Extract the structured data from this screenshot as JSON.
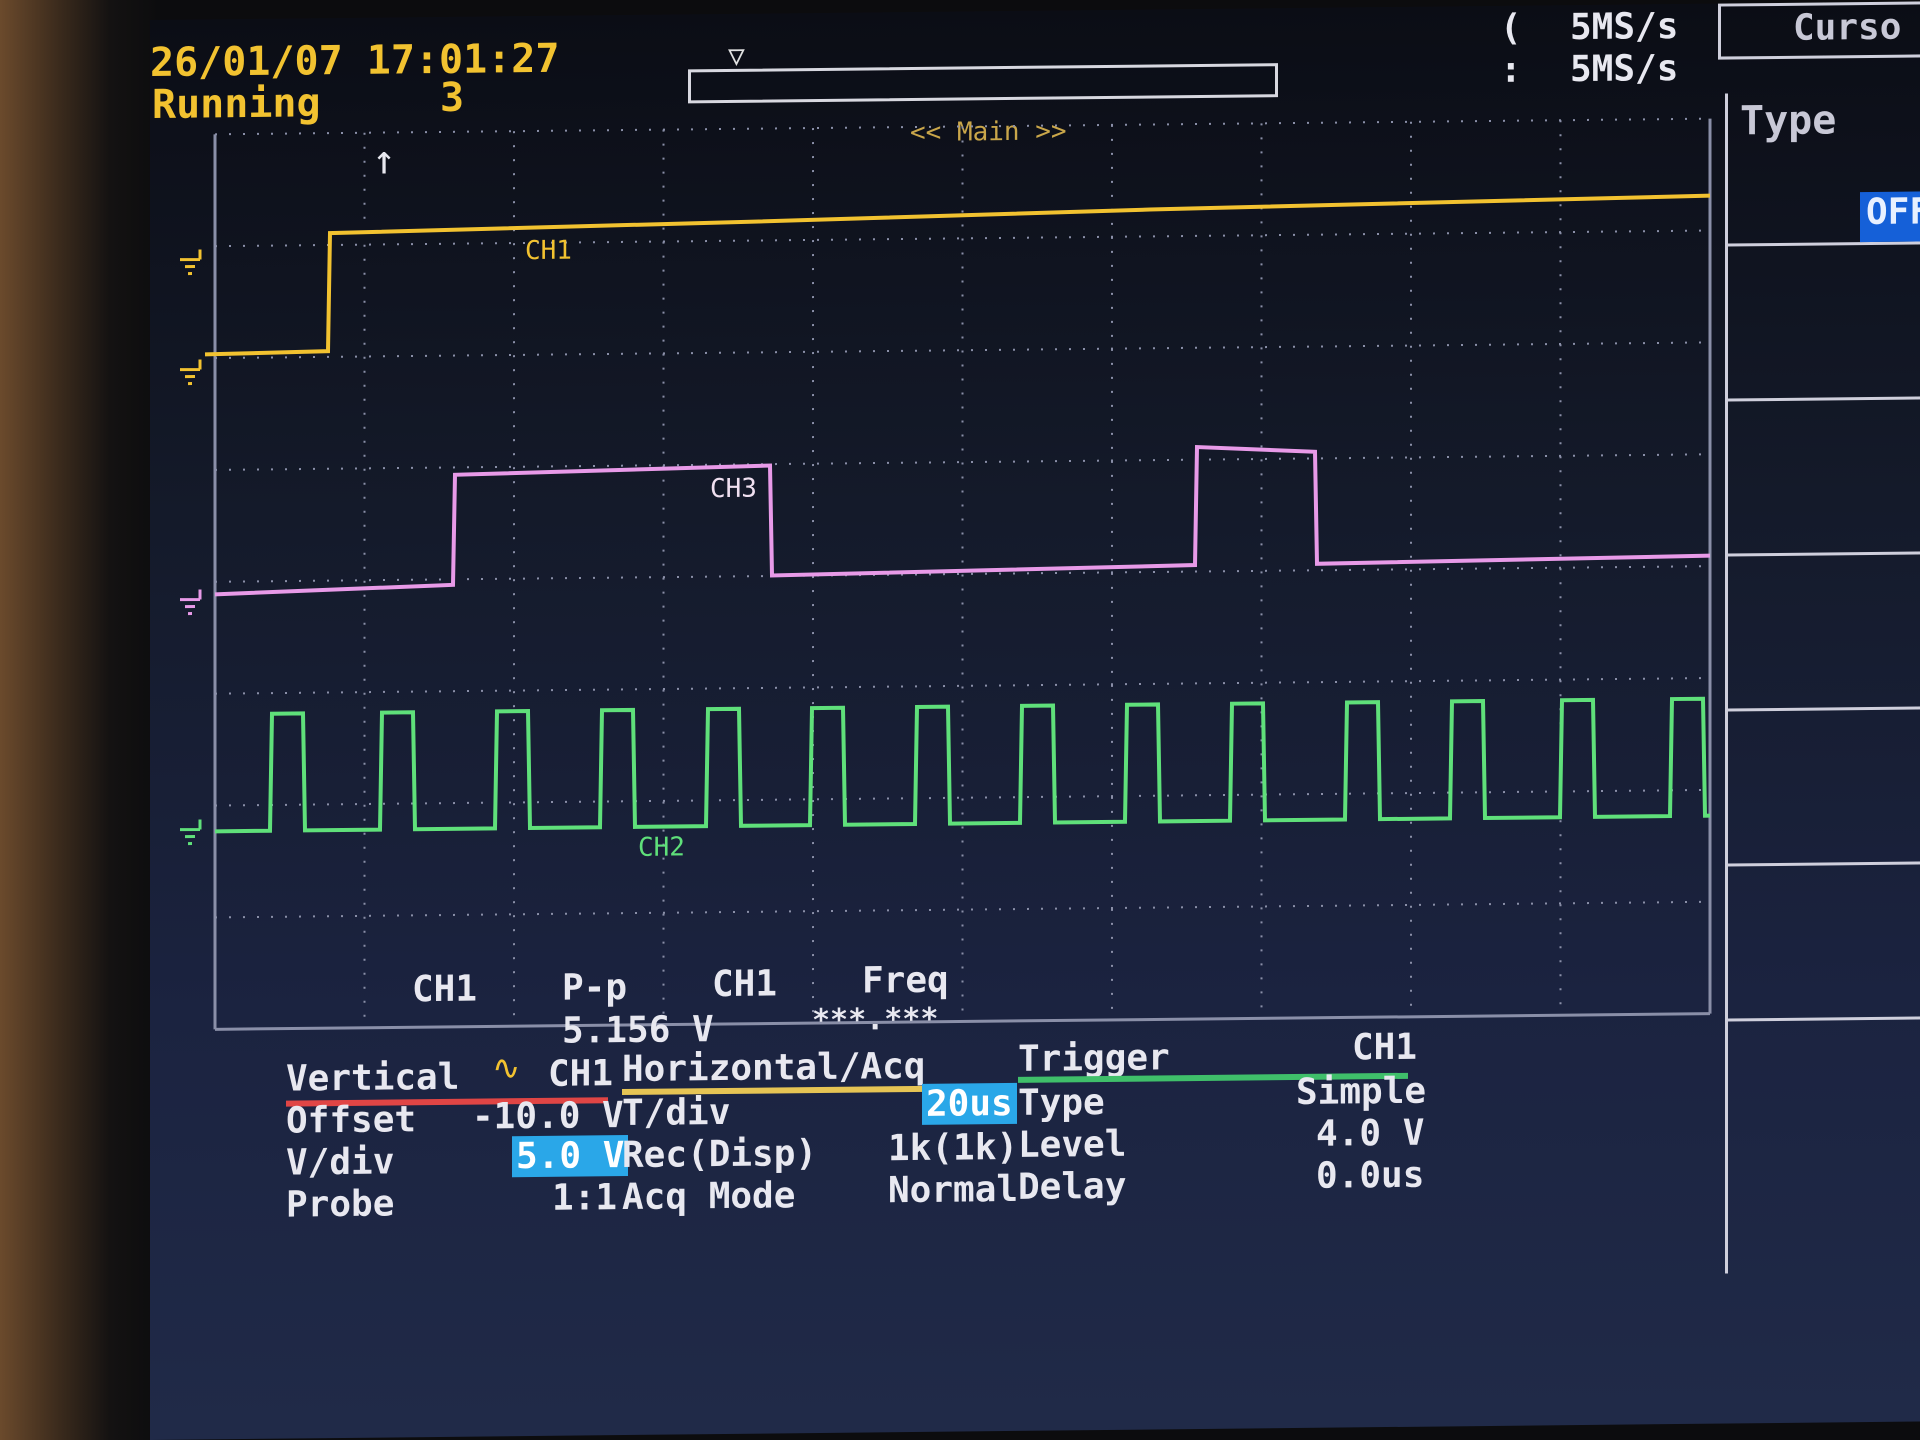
{
  "header": {
    "datetime": "26/01/07 17:01:27",
    "status": "Running",
    "acq_count": "3",
    "sample_rate_1": "5MS/s",
    "sample_rate_2": "5MS/s",
    "sample_rate_prefix_1": "(",
    "sample_rate_prefix_2": ":",
    "window_label": "<< Main >>",
    "trigger_arrow": "↑"
  },
  "side_menu": {
    "tab_label": "Curso",
    "type_label": "Type",
    "type_value": "OFF"
  },
  "channels": {
    "ch1_label": "CH1",
    "ch2_label": "CH2",
    "ch3_label": "CH3"
  },
  "measure": {
    "m1_channel": "CH1",
    "m1_name": "P-p",
    "m1_value": "5.156 V",
    "m2_channel": "CH1",
    "m2_name": "Freq",
    "m2_value": "***.***"
  },
  "vertical": {
    "title": "Vertical",
    "channel": "CH1",
    "offset_label": "Offset",
    "offset_value": "-10.0 V",
    "vdiv_label": "V/div",
    "vdiv_value": "5.0 V",
    "probe_label": "Probe",
    "probe_value": "1:1"
  },
  "horizontal": {
    "title": "Horizontal/Acq",
    "tdiv_label": "T/div",
    "tdiv_value": "20us",
    "rec_label": "Rec(Disp)",
    "rec_value": "1k(1k)",
    "acq_label": "Acq Mode",
    "acq_value": "Normal"
  },
  "trigger": {
    "title": "Trigger",
    "source": "CH1",
    "type_label": "Type",
    "type_value": "Simple",
    "level_label": "Level",
    "level_value": "4.0 V",
    "delay_label": "Delay",
    "delay_value": "0.0us"
  },
  "colors": {
    "ch1": "#f2c230",
    "ch2": "#5fe07a",
    "ch3": "#e89ae8",
    "grid": "#8a8fa8"
  }
}
